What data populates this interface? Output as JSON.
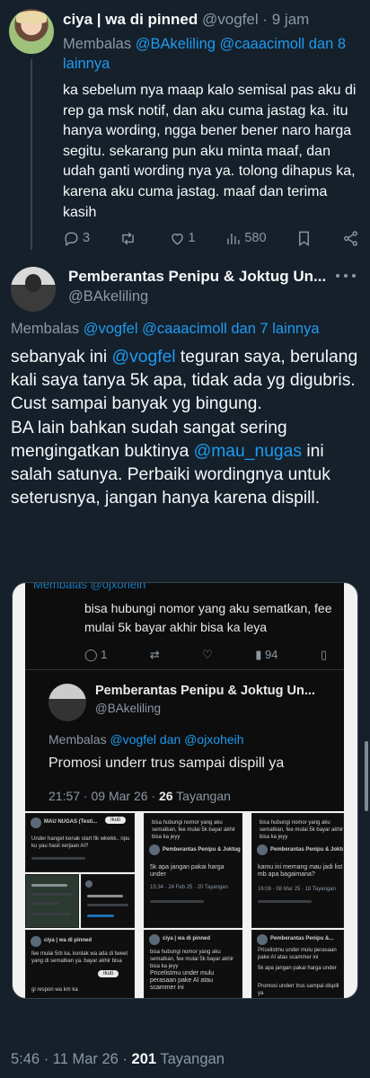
{
  "reply_tweet": {
    "display_name": "ciya | wa di pinned",
    "handle": "@vogfel",
    "time": "9 jam",
    "replying_prefix": "Membalas",
    "replying_to": "@BAkeliling @caaacimoll dan 8 lainnya",
    "body": "ka sebelum nya maap kalo semisal pas aku di rep ga msk notif, dan aku cuma jastag ka. itu hanya wording, ngga bener bener naro harga segitu. sekarang pun aku minta maaf, dan udah ganti wording nya ya. tolong dihapus ka, karena aku cuma jastag. maaf dan terima kasih",
    "reply_count": "3",
    "retweet_count": "",
    "like_count": "1",
    "view_count": "580"
  },
  "main_tweet": {
    "display_name": "Pemberantas Penipu & Joktug Un...",
    "handle": "@BAkeliling",
    "replying_prefix": "Membalas",
    "replying_to": "@vogfel @caaacimoll dan 7 lainnya",
    "body_1": "sebanyak ini ",
    "mention_1": "@vogfel",
    "body_2": " teguran saya, berulang kali saya tanya 5k apa, tidak ada yg digubris. Cust sampai banyak yg bingung.",
    "body_3": "BA lain bahkan sudah sangat sering mengingatkan buktinya ",
    "mention_2": "@mau_nugas",
    "body_4": " ini salah satunya. Perbaiki wordingnya untuk seterusnya, jangan hanya karena dispill.",
    "time": "5:46 · 11 Mar 26 · ",
    "views": "201",
    "views_label": " Tayangan"
  },
  "embedded_image": {
    "top_clip": "Membalas @ojxoheih",
    "quoted_text": "bisa hubungi nomor yang aku sematkan, fee mulai 5k bayar akhir bisa ka leya",
    "quoted_replies": "1",
    "quoted_views": "94",
    "name": "Pemberantas Penipu & Joktug Un...",
    "handle": "@BAkeliling",
    "replying_prefix": "Membalas ",
    "replying_to": "@vogfel dan @ojxoheih",
    "body": "Promosi underr trus sampai dispill ya",
    "time": "21:57 · 09 Mar 26 · ",
    "views": "26",
    "views_label": " Tayangan",
    "thumbs": {
      "c1_title": "MAU NUGAS (Testi...",
      "c1_button": "Ikuti",
      "c1_line": "Under hanget kenak start fik wkwkk.. ripu ku yau hasil xerjaan AI?",
      "c2_line": "bisa hubungi nomor yang aku sematkan, fee mulai 5k bayar akhir bisa ka jeyy",
      "c2_name": "Pemberantas Penipu & Joktug Un...",
      "c2_text": "5k apa jangan pakai harga under",
      "c2_time": "15:34 · 24 Feb 25 · 20 Tayangan",
      "c3_line": "bisa hubungi nomor yang aku sematkan, fee mulai 5k bayar akhir bisa ka jeyy",
      "c3_name": "Pemberantas Penipu & Joktug Un...",
      "c3_text": "kamu ini memang mau jadi list mb apa bagaimana?",
      "c3_time": "16:08 · 08 Mar 25 · 18 Tayangan",
      "c4_name": "ciya | wa di pinned",
      "c4_text": "fee mulai 5rb ka, kontak wa ada di tweet yang di sematkan ya. bayar akhir bisa",
      "c4_reply": "gi respon wa km ka",
      "c4_button": "Ikuti",
      "c5_name": "ciya | wa di pinned",
      "c5_line": "bisa hubungi nomor yang aku sematkan, fee mulai 5k bayar akhir bisa ka jeyy",
      "c5_text": "Pricelistmu under mulu perasaan pake AI atau scammer ini",
      "c6_name": "Pemberantas Penipu &...",
      "c6_text": "Pricelistmu under mulu perasaan pake AI atau scammer ini",
      "c6_text2": "5k apa jangan pakai harga under",
      "c6_text3": "Promosi underr trus sampai dispill ya"
    }
  }
}
